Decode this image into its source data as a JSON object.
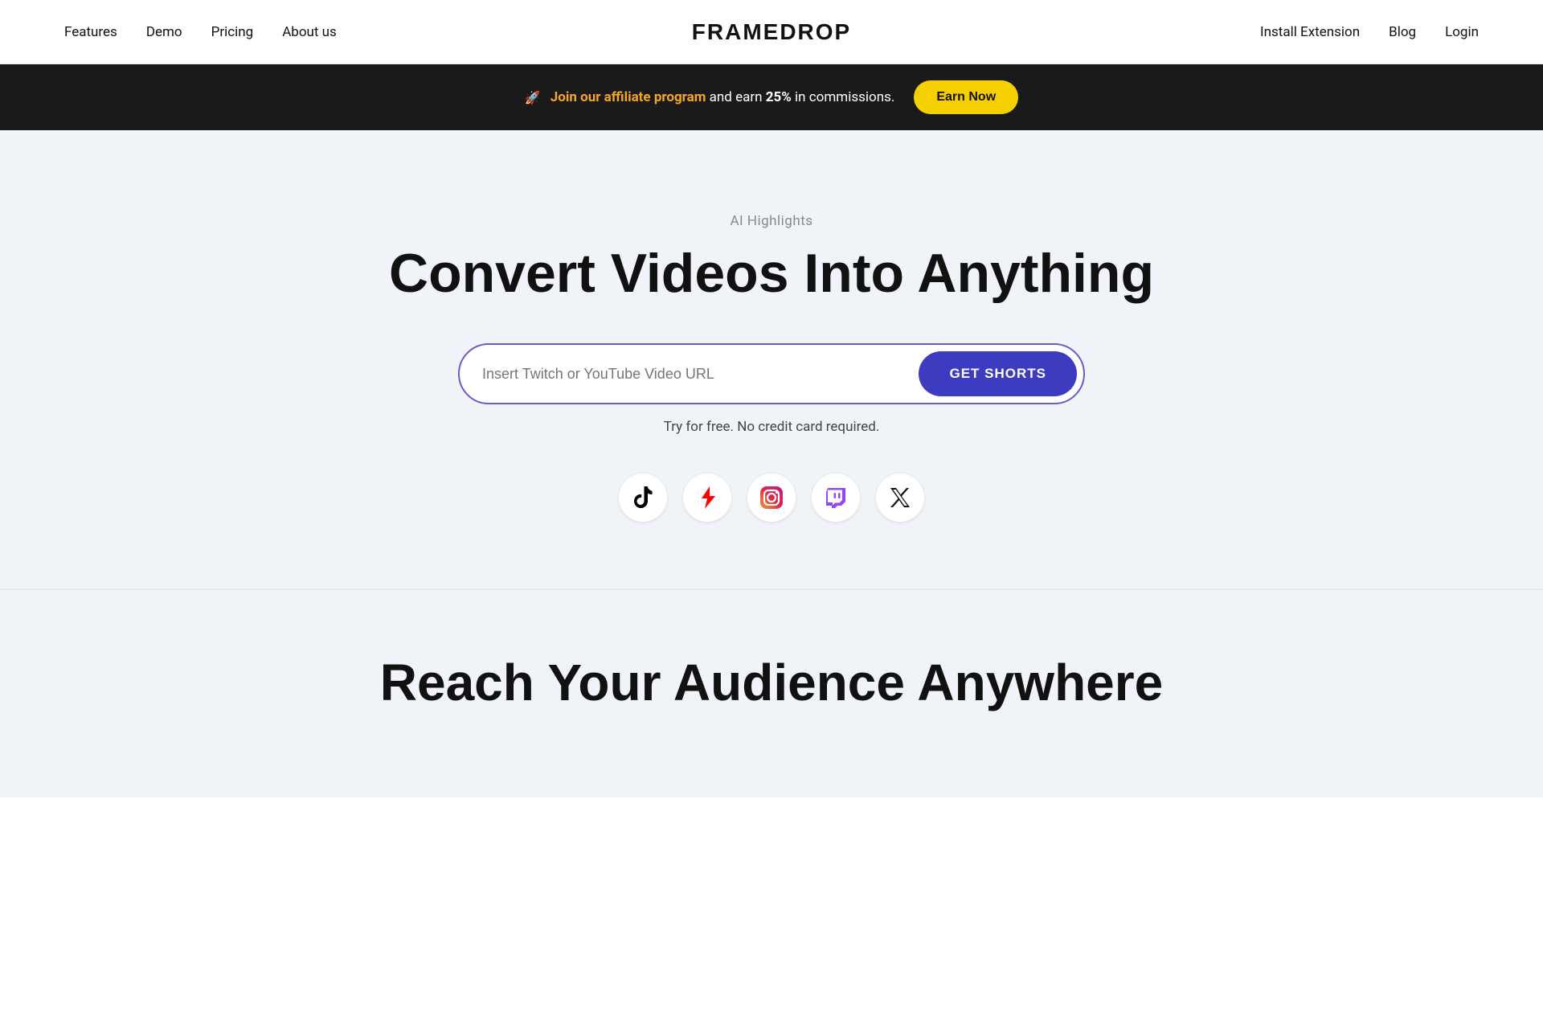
{
  "navbar": {
    "logo": "FRAMEDROP",
    "nav_left": [
      {
        "label": "Features",
        "href": "#"
      },
      {
        "label": "Demo",
        "href": "#"
      },
      {
        "label": "Pricing",
        "href": "#"
      },
      {
        "label": "About us",
        "href": "#"
      }
    ],
    "nav_right": [
      {
        "label": "Install Extension",
        "href": "#"
      },
      {
        "label": "Blog",
        "href": "#"
      },
      {
        "label": "Login",
        "href": "#"
      }
    ]
  },
  "banner": {
    "rocket_emoji": "🚀",
    "link_text": "Join our affiliate program",
    "middle_text": " and earn ",
    "bold_text": "25%",
    "after_bold": " in commissions.",
    "cta_label": "Earn Now"
  },
  "hero": {
    "subtitle": "AI Highlights",
    "title": "Convert Videos Into Anything",
    "input_placeholder": "Insert Twitch or YouTube Video URL",
    "cta_label": "GET SHORTS",
    "free_text": "Try for free. No credit card required.",
    "social_icons": [
      {
        "name": "tiktok",
        "label": "TikTok"
      },
      {
        "name": "youtube-shorts",
        "label": "YouTube Shorts"
      },
      {
        "name": "instagram",
        "label": "Instagram"
      },
      {
        "name": "twitch",
        "label": "Twitch"
      },
      {
        "name": "x",
        "label": "X (Twitter)"
      }
    ]
  },
  "section2": {
    "title": "Reach Your Audience Anywhere"
  }
}
